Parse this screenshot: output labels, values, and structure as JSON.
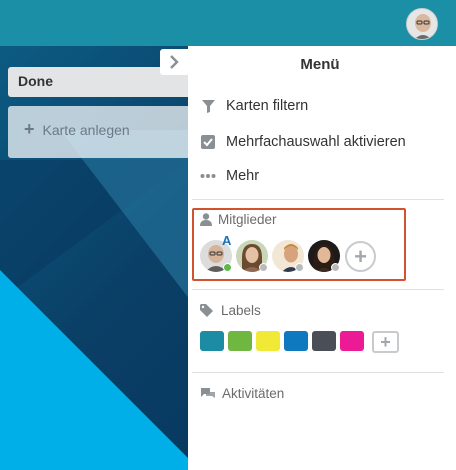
{
  "list": {
    "title": "Done",
    "add_card_label": "Karte anlegen"
  },
  "menu": {
    "title": "Menü",
    "items": [
      {
        "label": "Karten filtern",
        "icon": "filter-icon"
      },
      {
        "label": "Mehrfachauswahl aktivieren",
        "icon": "checkbox-icon"
      },
      {
        "label": "Mehr",
        "icon": "more-dots-icon"
      }
    ],
    "members": {
      "label": "Mitglieder",
      "admin_badge": "A"
    },
    "labels": {
      "label": "Labels",
      "colors": [
        "#1c8ca5",
        "#70b742",
        "#f0e936",
        "#0f79bf",
        "#4a4f57",
        "#ec1a94"
      ]
    },
    "activity": {
      "label": "Aktivitäten"
    }
  },
  "colors": {
    "header": "#1a8fa6",
    "highlight_border": "#d0532e",
    "online": "#5fb84a",
    "offline": "#b8bbbe"
  }
}
